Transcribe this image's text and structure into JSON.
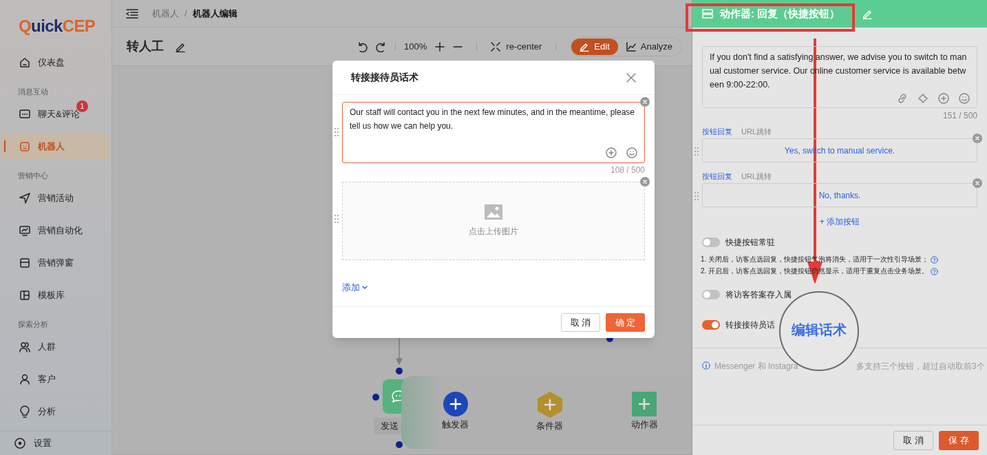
{
  "sidebar": {
    "logo": [
      {
        "text": "Q",
        "color": "#d9652b"
      },
      {
        "text": "uick",
        "color": "#1f2a6b"
      },
      {
        "text": "CEP",
        "color": "#d9652b"
      }
    ],
    "items": [
      {
        "kind": "item",
        "label": "仪表盘",
        "selected": false
      },
      {
        "kind": "section",
        "label": "消息互动"
      },
      {
        "kind": "item",
        "label": "聊天&评论",
        "badge": "1",
        "selected": false
      },
      {
        "kind": "item",
        "label": "机器人",
        "selected": true
      },
      {
        "kind": "section",
        "label": "营销中心"
      },
      {
        "kind": "item",
        "label": "营销活动",
        "selected": false
      },
      {
        "kind": "item",
        "label": "营销自动化",
        "selected": false
      },
      {
        "kind": "item",
        "label": "营销弹窗",
        "selected": false
      },
      {
        "kind": "item",
        "label": "模板库",
        "selected": false
      },
      {
        "kind": "section",
        "label": "探索分析"
      },
      {
        "kind": "item",
        "label": "人群",
        "selected": false
      },
      {
        "kind": "item",
        "label": "客户",
        "selected": false
      },
      {
        "kind": "item",
        "label": "分析",
        "selected": false
      }
    ],
    "settings": "设置"
  },
  "breadcrumb": [
    "机器人",
    "机器人编辑"
  ],
  "breadcrumb_separator": "/",
  "page_title": "转人工",
  "toolbar": {
    "zoom": "100%",
    "recenter": "re-center",
    "modes": [
      {
        "label": "Edit",
        "selected": true
      },
      {
        "label": "Analyze",
        "selected": false
      }
    ]
  },
  "canvas": {
    "node_label": "发送",
    "palette": [
      {
        "kind": "trigger",
        "label": "触发器"
      },
      {
        "kind": "condition",
        "label": "条件器"
      },
      {
        "kind": "action",
        "label": "动作器"
      }
    ]
  },
  "modal": {
    "title": "转接接待员话术",
    "message": "Our staff will contact you in the next few minutes, and in the meantime, please tell us how we can help you.",
    "count": "108 / 500",
    "upload": "点击上传图片",
    "add": "添加",
    "cancel": "取 消",
    "ok": "确 定"
  },
  "panel": {
    "title": "动作器: 回复（快捷按钮）",
    "message": "If you don't find a satisfying answer, we advise you to switch to manual customer service. Our online customer service is available between 9:00-22:00.",
    "count": "151 / 500",
    "quick_buttons": [
      {
        "tabs": [
          {
            "label": "按钮回复",
            "selected": true
          },
          {
            "label": "URL跳转",
            "selected": false
          }
        ],
        "text": "Yes, switch to manual service."
      },
      {
        "tabs": [
          {
            "label": "按钮回复",
            "selected": true
          },
          {
            "label": "URL跳转",
            "selected": false
          }
        ],
        "text": "No, thanks."
      }
    ],
    "add_button": "+ 添加按钮",
    "pin_toggle": {
      "label": "快捷按钮常驻",
      "on": false
    },
    "notes": [
      "1. 关闭后，访客点选回复，快捷按钮气泡将消失，适用于一次性引导场景；",
      "2. 开启后，访客点选回复，快捷按钮仍然显示，适用于重复点击业务场景。"
    ],
    "toggles": [
      {
        "label": "将访客答案存入属",
        "on": false
      },
      {
        "label": "转接接待员话",
        "on": true
      }
    ],
    "notice": [
      "Messenger 和 Instagra",
      "多支持三个按钮，超过自动取前3个"
    ],
    "cancel": "取 消",
    "save": "保 存"
  },
  "annotation": {
    "magnified": "编辑话术"
  }
}
